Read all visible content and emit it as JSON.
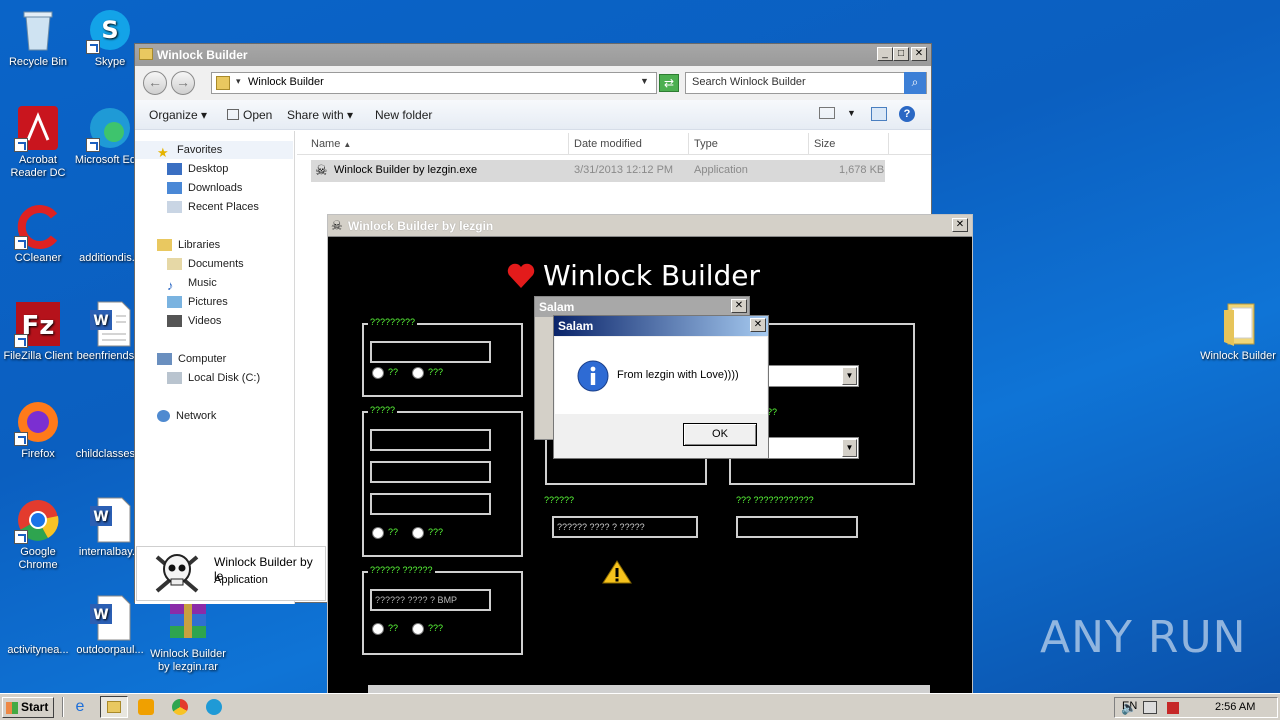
{
  "desktop": {
    "icons": [
      {
        "label": "Recycle Bin"
      },
      {
        "label": "Skype"
      },
      {
        "label": "Acrobat Reader DC"
      },
      {
        "label": "Microsoft Ed..."
      },
      {
        "label": "CCleaner"
      },
      {
        "label": "additiondis..."
      },
      {
        "label": "FileZilla Client"
      },
      {
        "label": "beenfriends..."
      },
      {
        "label": "Firefox"
      },
      {
        "label": "childclasses..."
      },
      {
        "label": "Google Chrome"
      },
      {
        "label": "internalbay..."
      },
      {
        "label": "activitynea..."
      },
      {
        "label": "outdoorpaul..."
      },
      {
        "label": "Winlock Builder by lezgin.rar"
      },
      {
        "label": "Winlock Builder"
      }
    ]
  },
  "explorer": {
    "title": "Winlock Builder",
    "address": "Winlock Builder",
    "search_placeholder": "Search Winlock Builder",
    "toolbar": {
      "organize": "Organize",
      "open": "Open",
      "share_with": "Share with",
      "new_folder": "New folder"
    },
    "nav": {
      "favorites": "Favorites",
      "desktop": "Desktop",
      "downloads": "Downloads",
      "recent_places": "Recent Places",
      "libraries": "Libraries",
      "documents": "Documents",
      "music": "Music",
      "pictures": "Pictures",
      "videos": "Videos",
      "computer": "Computer",
      "local_disk": "Local Disk (C:)",
      "network": "Network"
    },
    "columns": {
      "name": "Name",
      "date_modified": "Date modified",
      "type": "Type",
      "size": "Size"
    },
    "files": [
      {
        "name": "Winlock Builder by lezgin.exe",
        "date": "3/31/2013 12:12 PM",
        "type": "Application",
        "size": "1,678 KB"
      }
    ]
  },
  "popup": {
    "name": "Winlock Builder by le",
    "type": "Application"
  },
  "winlock": {
    "title": "Winlock Builder by lezgin",
    "heading": "Winlock Builder",
    "group1": {
      "label": "?????????",
      "radio1": "??",
      "radio2": "???"
    },
    "group2": {
      "label": "?????",
      "radio1": "??",
      "radio2": "???"
    },
    "group3": {
      "label": "?????? ??????",
      "field": "?????? ???? ? BMP",
      "radio1": "??",
      "radio2": "???"
    },
    "right_label1": "??",
    "bottom_label_left": "??????",
    "bottom_field_left": "?????? ???? ? ?????",
    "bottom_label_right": "??? ????????????"
  },
  "dialog_back": {
    "title": "Salam"
  },
  "dialog": {
    "title": "Salam",
    "message": "From lezgin with Love))))",
    "ok": "OK"
  },
  "taskbar": {
    "start": "Start",
    "lang": "EN",
    "time": "2:56 AM"
  },
  "watermark": "ANY RUN"
}
